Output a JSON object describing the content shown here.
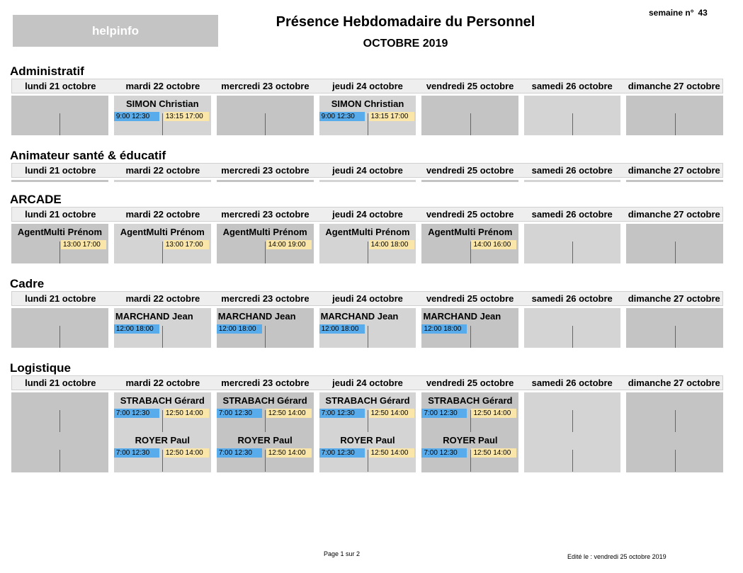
{
  "header": {
    "logo": "helpinfo",
    "title": "Présence Hebdomadaire du Personnel",
    "subtitle": "OCTOBRE 2019",
    "week_label": "semaine n°",
    "week_number": "43"
  },
  "days": [
    "lundi 21 octobre",
    "mardi 22 octobre",
    "mercredi 23 octobre",
    "jeudi 24 octobre",
    "vendredi 25 octobre",
    "samedi 26 octobre",
    "dimanche 27 octobre"
  ],
  "colors": {
    "cell_dark": "#c4c4c4",
    "cell_light": "#d4d4d4",
    "chip_am": "#59aceb",
    "chip_pm": "#fbe6a9"
  },
  "sections": [
    {
      "name": "Administratif",
      "cells": [
        {
          "entries": []
        },
        {
          "entries": [
            {
              "name": "SIMON Christian",
              "am": "9:00  12:30",
              "pm": "13:15  17:00"
            }
          ]
        },
        {
          "entries": []
        },
        {
          "entries": [
            {
              "name": "SIMON Christian",
              "am": "9:00  12:30",
              "pm": "13:15  17:00"
            }
          ]
        },
        {
          "entries": []
        },
        {
          "entries": []
        },
        {
          "entries": []
        }
      ]
    },
    {
      "name": "Animateur santé & éducatif",
      "cells": []
    },
    {
      "name": "ARCADE",
      "cells": [
        {
          "entries": [
            {
              "name": "AgentMulti Prénom",
              "pm": "13:00  17:00"
            }
          ]
        },
        {
          "entries": [
            {
              "name": "AgentMulti Prénom",
              "pm": "13:00  17:00"
            }
          ]
        },
        {
          "entries": [
            {
              "name": "AgentMulti Prénom",
              "pm": "14:00  19:00"
            }
          ]
        },
        {
          "entries": [
            {
              "name": "AgentMulti Prénom",
              "pm": "14:00  18:00"
            }
          ]
        },
        {
          "entries": [
            {
              "name": "AgentMulti Prénom",
              "pm": "14:00  16:00"
            }
          ]
        },
        {
          "entries": []
        },
        {
          "entries": []
        }
      ]
    },
    {
      "name": "Cadre",
      "cells": [
        {
          "entries": []
        },
        {
          "entries": [
            {
              "name": "MARCHAND Jean",
              "am": "12:00  18:00",
              "left": true
            }
          ]
        },
        {
          "entries": [
            {
              "name": "MARCHAND Jean",
              "am": "12:00  18:00",
              "left": true
            }
          ]
        },
        {
          "entries": [
            {
              "name": "MARCHAND Jean",
              "am": "12:00  18:00",
              "left": true
            }
          ]
        },
        {
          "entries": [
            {
              "name": "MARCHAND Jean",
              "am": "12:00  18:00",
              "left": true
            }
          ]
        },
        {
          "entries": []
        },
        {
          "entries": []
        }
      ]
    },
    {
      "name": "Logistique",
      "cells": [
        {
          "entries": []
        },
        {
          "entries": [
            {
              "name": "STRABACH Gérard",
              "am": "7:00  12:30",
              "pm": "12:50  14:00"
            },
            {
              "name": "ROYER Paul",
              "am": "7:00  12:30",
              "pm": "12:50  14:00"
            }
          ]
        },
        {
          "entries": [
            {
              "name": "STRABACH Gérard",
              "am": "7:00  12:30",
              "pm": "12:50  14:00"
            },
            {
              "name": "ROYER Paul",
              "am": "7:00  12:30",
              "pm": "12:50  14:00"
            }
          ]
        },
        {
          "entries": [
            {
              "name": "STRABACH Gérard",
              "am": "7:00  12:30",
              "pm": "12:50  14:00"
            },
            {
              "name": "ROYER Paul",
              "am": "7:00  12:30",
              "pm": "12:50  14:00"
            }
          ]
        },
        {
          "entries": [
            {
              "name": "STRABACH Gérard",
              "am": "7:00  12:30",
              "pm": "12:50  14:00"
            },
            {
              "name": "ROYER Paul",
              "am": "7:00  12:30",
              "pm": "12:50  14:00"
            }
          ]
        },
        {
          "entries": []
        },
        {
          "entries": []
        }
      ]
    }
  ],
  "footer": {
    "page": "Page 1 sur 2",
    "edited": "Edité le : vendredi 25 octobre 2019"
  }
}
